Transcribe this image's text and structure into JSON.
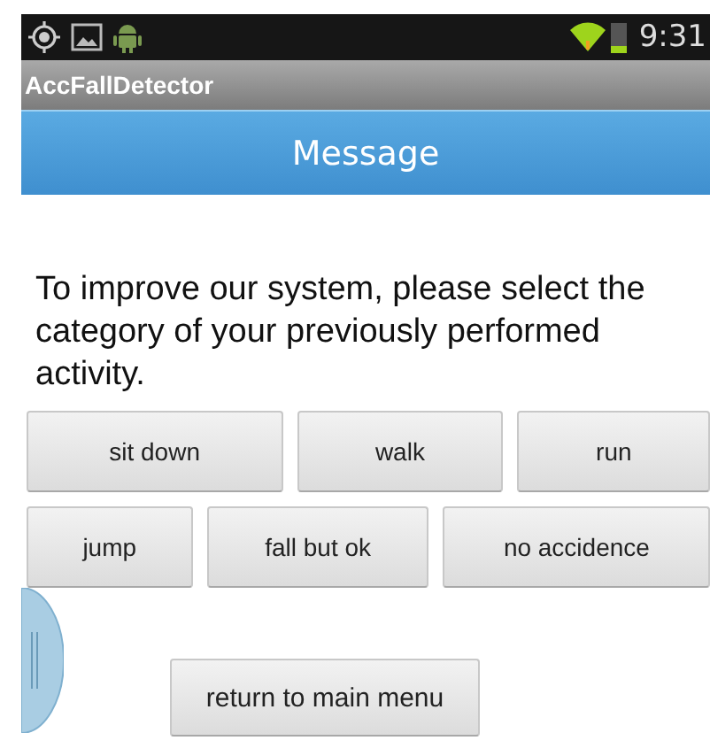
{
  "status_bar": {
    "time": "9:31"
  },
  "app_bar": {
    "title": "AccFallDetector"
  },
  "header": {
    "title": "Message"
  },
  "message": "To improve our system, please select the category of your previously performed activity.",
  "activity_rows": [
    [
      "sit down",
      "walk",
      "run"
    ],
    [
      "jump",
      "fall but ok",
      "no accidence"
    ]
  ],
  "return_button": "return to main menu"
}
